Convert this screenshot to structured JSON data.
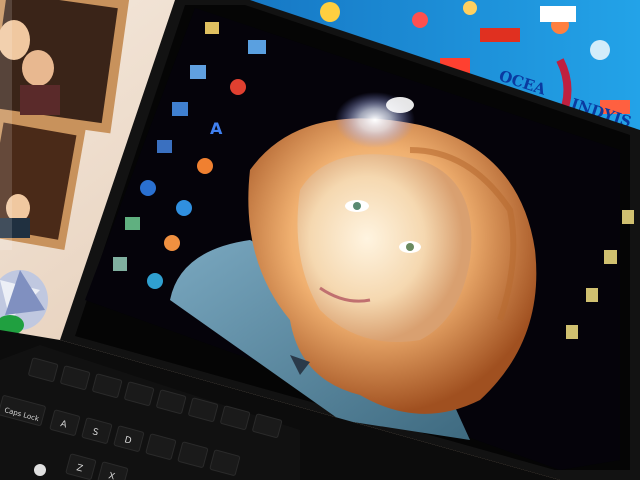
{
  "scene": {
    "description_kind": "photo",
    "poster": {
      "text_lines": [
        "OCEA",
        "INDYJS"
      ]
    },
    "desktop": {
      "left_icons": [
        {
          "icon": "folder-icon"
        },
        {
          "icon": "computer-icon"
        },
        {
          "icon": "network-icon"
        },
        {
          "icon": "recycle-bin-icon"
        },
        {
          "icon": "app-icon"
        },
        {
          "icon": "browser-icon"
        },
        {
          "icon": "internet-explorer-icon"
        },
        {
          "icon": "messenger-icon"
        },
        {
          "icon": "app-icon"
        },
        {
          "icon": "app-icon"
        },
        {
          "icon": "app-icon"
        },
        {
          "icon": "skype-icon"
        }
      ],
      "right_icons": [
        {
          "icon": "file-icon"
        },
        {
          "icon": "file-icon"
        },
        {
          "icon": "file-icon"
        },
        {
          "icon": "file-icon"
        }
      ]
    },
    "keyboard": {
      "visible_key_labels": [
        "Caps Lock",
        "A",
        "S",
        "D",
        "Z",
        "X"
      ]
    },
    "colors": {
      "poster_blue": "#1a8fd8",
      "bezel": "#111111",
      "hair": "#e8a060",
      "sweater": "#5a8aa0",
      "frame_wood": "#c89060"
    }
  }
}
